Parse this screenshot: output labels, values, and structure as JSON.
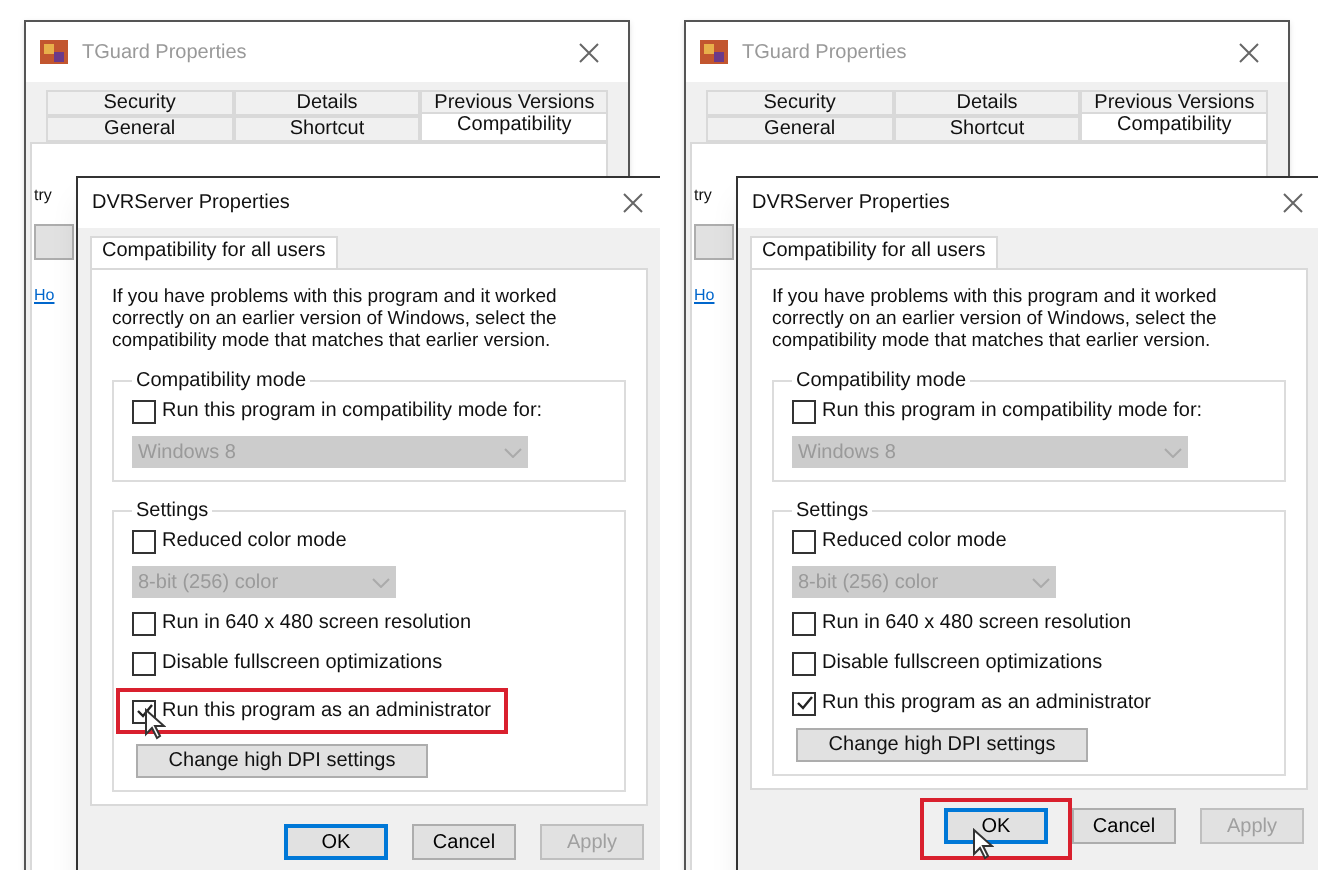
{
  "panels": [
    {
      "back_window": {
        "title": "TGuard Properties",
        "tab_rows": [
          [
            {
              "label": "Security",
              "selected": false
            },
            {
              "label": "Details",
              "selected": false
            },
            {
              "label": "Previous Versions",
              "selected": false
            }
          ],
          [
            {
              "label": "General",
              "selected": false
            },
            {
              "label": "Shortcut",
              "selected": false
            },
            {
              "label": "Compatibility",
              "selected": true
            }
          ]
        ],
        "fragments": [
          "try"
        ],
        "link_fragment": "Ho"
      },
      "front_window": {
        "title": "DVRServer Properties",
        "tab": {
          "label": "Compatibility for all users",
          "selected": true
        },
        "intro": "If you have problems with this program and it worked correctly on an earlier version of Windows, select the compatibility mode that matches that earlier version.",
        "groups": [
          {
            "title": "Compatibility mode",
            "items": [
              {
                "kind": "checkbox",
                "label": "Run this program in compatibility mode for:",
                "checked": false,
                "highlighted": false
              },
              {
                "kind": "dropdown",
                "value": "Windows 8",
                "disabled": true
              }
            ]
          },
          {
            "title": "Settings",
            "items": [
              {
                "kind": "checkbox",
                "label": "Reduced color mode",
                "checked": false,
                "highlighted": false
              },
              {
                "kind": "dropdown",
                "value": "8-bit (256) color",
                "disabled": true
              },
              {
                "kind": "checkbox",
                "label": "Run in 640 x 480 screen resolution",
                "checked": false,
                "highlighted": false
              },
              {
                "kind": "checkbox",
                "label": "Disable fullscreen optimizations",
                "checked": false,
                "highlighted": false
              },
              {
                "kind": "checkbox",
                "label": "Run this program as an administrator",
                "checked": true,
                "highlighted": true
              },
              {
                "kind": "button",
                "label": "Change high DPI settings"
              }
            ]
          }
        ],
        "buttons": [
          {
            "label": "OK",
            "default": true,
            "disabled": false,
            "highlighted": false
          },
          {
            "label": "Cancel",
            "default": false,
            "disabled": false,
            "highlighted": false
          },
          {
            "label": "Apply",
            "default": false,
            "disabled": true,
            "highlighted": false
          }
        ]
      }
    },
    {
      "back_window": {
        "title": "TGuard Properties",
        "tab_rows": [
          [
            {
              "label": "Security",
              "selected": false
            },
            {
              "label": "Details",
              "selected": false
            },
            {
              "label": "Previous Versions",
              "selected": false
            }
          ],
          [
            {
              "label": "General",
              "selected": false
            },
            {
              "label": "Shortcut",
              "selected": false
            },
            {
              "label": "Compatibility",
              "selected": true
            }
          ]
        ],
        "fragments": [
          "try"
        ],
        "link_fragment": "Ho"
      },
      "front_window": {
        "title": "DVRServer Properties",
        "tab": {
          "label": "Compatibility for all users",
          "selected": true
        },
        "intro": "If you have problems with this program and it worked correctly on an earlier version of Windows, select the compatibility mode that matches that earlier version.",
        "groups": [
          {
            "title": "Compatibility mode",
            "items": [
              {
                "kind": "checkbox",
                "label": "Run this program in compatibility mode for:",
                "checked": false,
                "highlighted": false
              },
              {
                "kind": "dropdown",
                "value": "Windows 8",
                "disabled": true
              }
            ]
          },
          {
            "title": "Settings",
            "items": [
              {
                "kind": "checkbox",
                "label": "Reduced color mode",
                "checked": false,
                "highlighted": false
              },
              {
                "kind": "dropdown",
                "value": "8-bit (256) color",
                "disabled": true
              },
              {
                "kind": "checkbox",
                "label": "Run in 640 x 480 screen resolution",
                "checked": false,
                "highlighted": false
              },
              {
                "kind": "checkbox",
                "label": "Disable fullscreen optimizations",
                "checked": false,
                "highlighted": false
              },
              {
                "kind": "checkbox",
                "label": "Run this program as an administrator",
                "checked": true,
                "highlighted": false
              },
              {
                "kind": "button",
                "label": "Change high DPI settings"
              }
            ]
          }
        ],
        "buttons": [
          {
            "label": "OK",
            "default": true,
            "disabled": false,
            "highlighted": true
          },
          {
            "label": "Cancel",
            "default": false,
            "disabled": false,
            "highlighted": false
          },
          {
            "label": "Apply",
            "default": false,
            "disabled": true,
            "highlighted": false
          }
        ]
      }
    }
  ]
}
